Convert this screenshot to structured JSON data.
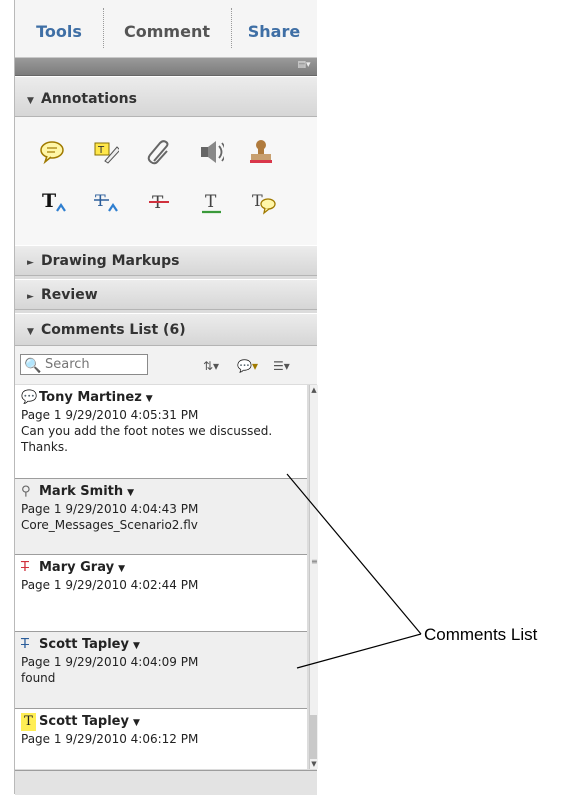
{
  "tabs": [
    "Tools",
    "Comment",
    "Share"
  ],
  "sections": {
    "annotations": "Annotations",
    "drawing_markups": "Drawing Markups",
    "review": "Review",
    "comments_list": "Comments List (6)"
  },
  "annotation_tools": [
    "sticky-note-icon",
    "highlight-text-icon",
    "attach-file-icon",
    "record-audio-icon",
    "stamp-icon",
    "insert-text-icon",
    "replace-text-icon",
    "strikethrough-icon",
    "underline-icon",
    "text-comment-icon"
  ],
  "search": {
    "placeholder": "Search"
  },
  "comments": [
    {
      "author": "Tony Martinez",
      "meta": "Page 1  9/29/2010 4:05:31 PM",
      "text": "Can you add the foot notes we discussed. Thanks.",
      "icon": "sticky-note-icon"
    },
    {
      "author": "Mark Smith",
      "meta": "Page 1  9/29/2010 4:04:43 PM",
      "text": "Core_Messages_Scenario2.flv",
      "icon": "attach-file-icon"
    },
    {
      "author": "Mary Gray",
      "meta": "Page 1  9/29/2010 4:02:44 PM",
      "text": "",
      "icon": "strikethrough-icon"
    },
    {
      "author": "Scott Tapley",
      "meta": "Page 1  9/29/2010 4:04:09 PM",
      "text": "found",
      "icon": "replace-text-icon"
    },
    {
      "author": "Scott Tapley",
      "meta": "Page 1  9/29/2010 4:06:12 PM",
      "text": "",
      "icon": "highlight-text-icon"
    }
  ],
  "callout": {
    "label": "Comments List"
  },
  "colors": {
    "tab_text": "#3f6fa5",
    "strike_red": "#d0313d",
    "underline_green": "#3a9a3a",
    "insert_blue": "#2f7fd0",
    "highlight_yellow": "#ffee55"
  }
}
